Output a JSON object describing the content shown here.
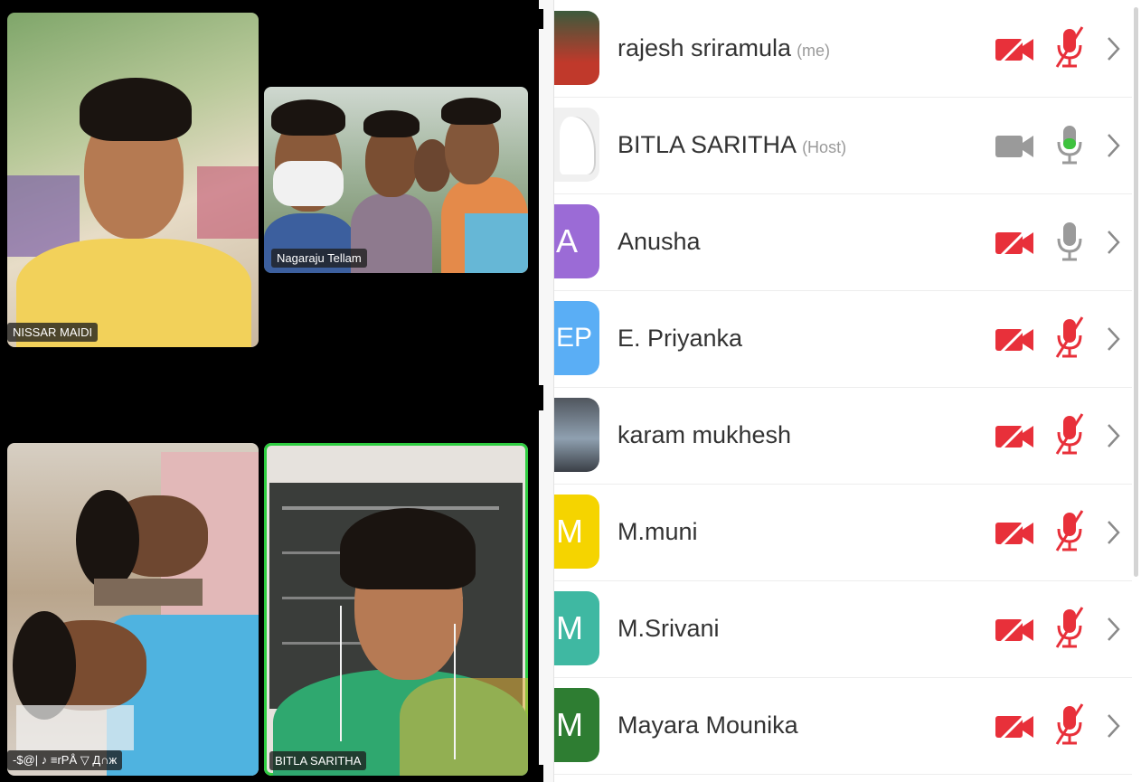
{
  "video_tiles": [
    {
      "name": "NISSAR MAIDI",
      "active": false
    },
    {
      "name": "Nagaraju Tellam",
      "active": false
    },
    {
      "name": "-$@| ♪ ≡rPÅ ▽ Д∩ж",
      "active": false
    },
    {
      "name": "BITLA SARITHA",
      "active": true
    }
  ],
  "participants": [
    {
      "name": "rajesh sriramula",
      "role": "(me)",
      "initial": "",
      "avatar_color": "#c0392b",
      "camera": "off",
      "mic": "muted"
    },
    {
      "name": "BITLA SARITHA",
      "role": "(Host)",
      "initial": "",
      "avatar_color": "#f0f0f0",
      "camera": "on",
      "mic": "active"
    },
    {
      "name": "Anusha",
      "role": "",
      "initial": "A",
      "avatar_color": "#9b6bd6",
      "camera": "off",
      "mic": "idle"
    },
    {
      "name": "E. Priyanka",
      "role": "",
      "initial": "EP",
      "avatar_color": "#5aaef5",
      "camera": "off",
      "mic": "muted"
    },
    {
      "name": "karam mukhesh",
      "role": "",
      "initial": "",
      "avatar_color": "#6a7480",
      "camera": "off",
      "mic": "muted"
    },
    {
      "name": "M.muni",
      "role": "",
      "initial": "M",
      "avatar_color": "#f5d400",
      "camera": "off",
      "mic": "muted"
    },
    {
      "name": "M.Srivani",
      "role": "",
      "initial": "M",
      "avatar_color": "#3fb8a2",
      "camera": "off",
      "mic": "muted"
    },
    {
      "name": "Mayara Mounika",
      "role": "",
      "initial": "M",
      "avatar_color": "#2e7d32",
      "camera": "off",
      "mic": "muted"
    }
  ],
  "colors": {
    "muted_red": "#e8303a",
    "active_green": "#3ec23e",
    "icon_grey": "#9a9a9a"
  }
}
